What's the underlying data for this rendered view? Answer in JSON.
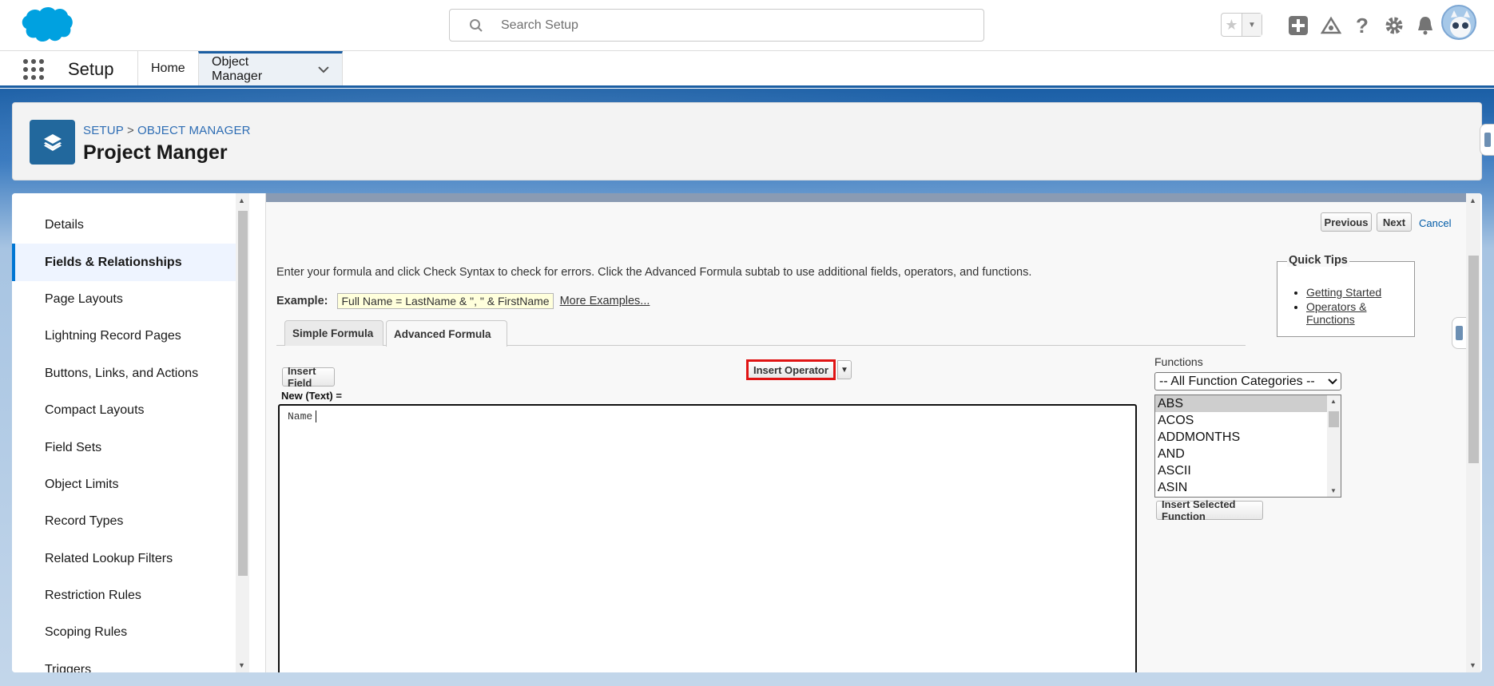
{
  "header": {
    "search_placeholder": "Search Setup"
  },
  "app_nav": {
    "app_name": "Setup",
    "tabs": [
      {
        "label": "Home"
      },
      {
        "label": "Object Manager"
      }
    ]
  },
  "page_header": {
    "breadcrumb": {
      "root": "SETUP",
      "separator": ">",
      "leaf": "OBJECT MANAGER"
    },
    "title": "Project Manger"
  },
  "sidebar": {
    "items": [
      {
        "label": "Details"
      },
      {
        "label": "Fields & Relationships"
      },
      {
        "label": "Page Layouts"
      },
      {
        "label": "Lightning Record Pages"
      },
      {
        "label": "Buttons, Links, and Actions"
      },
      {
        "label": "Compact Layouts"
      },
      {
        "label": "Field Sets"
      },
      {
        "label": "Object Limits"
      },
      {
        "label": "Record Types"
      },
      {
        "label": "Related Lookup Filters"
      },
      {
        "label": "Restriction Rules"
      },
      {
        "label": "Scoping Rules"
      },
      {
        "label": "Triggers"
      }
    ],
    "active_index": 1
  },
  "formula_editor": {
    "buttons": {
      "previous": "Previous",
      "next": "Next",
      "cancel": "Cancel"
    },
    "intro": "Enter your formula and click Check Syntax to check for errors. Click the Advanced Formula subtab to use additional fields, operators, and functions.",
    "example_label": "Example:",
    "example_text": "Full Name = LastName & \", \" & FirstName",
    "more_examples": "More Examples...",
    "quick_tips": {
      "title": "Quick Tips",
      "links": [
        "Getting Started",
        "Operators & Functions"
      ]
    },
    "tabs": [
      {
        "label": "Simple Formula"
      },
      {
        "label": "Advanced Formula"
      }
    ],
    "active_tab": "Advanced Formula",
    "insert_field": "Insert Field",
    "insert_operator": "Insert Operator",
    "insert_operator_caret": "▼",
    "functions_label": "Functions",
    "function_category": "-- All Function Categories --",
    "functions": [
      "ABS",
      "ACOS",
      "ADDMONTHS",
      "AND",
      "ASCII",
      "ASIN"
    ],
    "selected_function": "ABS",
    "insert_selected_function": "Insert Selected Function",
    "field_label": "New (Text) =",
    "formula_value": "Name"
  },
  "colors": {
    "brand": "#0176d3",
    "nav_accent": "#1b5ea2",
    "highlight_border": "#e01414"
  }
}
